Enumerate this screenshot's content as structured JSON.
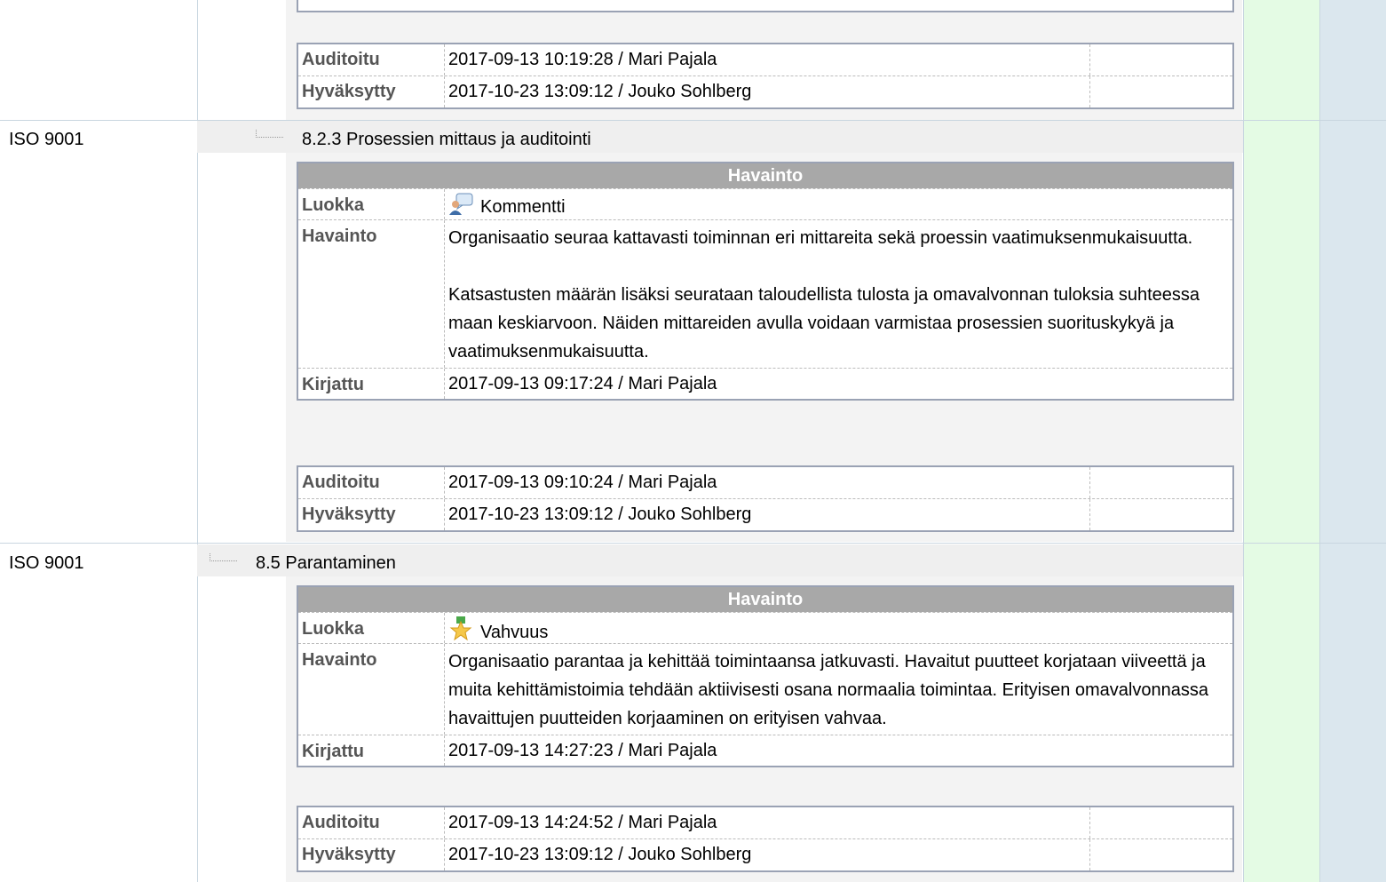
{
  "top_block": {
    "audited_label": "Auditoitu",
    "audited_value": "2017-09-13 10:19:28 / Mari Pajala",
    "approved_label": "Hyväksytty",
    "approved_value": "2017-10-23 13:09:12 / Jouko Sohlberg"
  },
  "sections": [
    {
      "standard": "ISO 9001",
      "title": "8.2.3 Prosessien mittaus ja auditointi",
      "header": "Havainto",
      "category_label": "Luokka",
      "category_icon": "comment-icon",
      "category_value": "Kommentti",
      "finding_label": "Havainto",
      "finding_para1": "Organisaatio seuraa kattavasti toiminnan eri mittareita sekä proessin vaatimuksenmukaisuutta.",
      "finding_para2": "Katsastusten määrän lisäksi seurataan taloudellista tulosta ja omavalvonnan tuloksia suhteessa maan keskiarvoon. Näiden mittareiden avulla voidaan varmistaa prosessien suorituskykyä ja vaatimuksenmukaisuutta.",
      "recorded_label": "Kirjattu",
      "recorded_value": "2017-09-13 09:17:24 / Mari Pajala",
      "audited_label": "Auditoitu",
      "audited_value": "2017-09-13 09:10:24 / Mari Pajala",
      "approved_label": "Hyväksytty",
      "approved_value": "2017-10-23 13:09:12 / Jouko Sohlberg"
    },
    {
      "standard": "ISO 9001",
      "title": "8.5 Parantaminen",
      "header": "Havainto",
      "category_label": "Luokka",
      "category_icon": "star-medal-icon",
      "category_value": "Vahvuus",
      "finding_label": "Havainto",
      "finding_para1": "Organisaatio parantaa ja kehittää toimintaansa jatkuvasti. Havaitut puutteet korjataan viiveettä ja muita kehittämistoimia tehdään aktiivisesti osana normaalia toimintaa. Erityisen omavalvonnassa havaittujen puutteiden korjaaminen on erityisen vahvaa.",
      "recorded_label": "Kirjattu",
      "recorded_value": "2017-09-13 14:27:23 / Mari Pajala",
      "audited_label": "Auditoitu",
      "audited_value": "2017-09-13 14:24:52 / Mari Pajala",
      "approved_label": "Hyväksytty",
      "approved_value": "2017-10-23 13:09:12 / Jouko Sohlberg"
    }
  ]
}
